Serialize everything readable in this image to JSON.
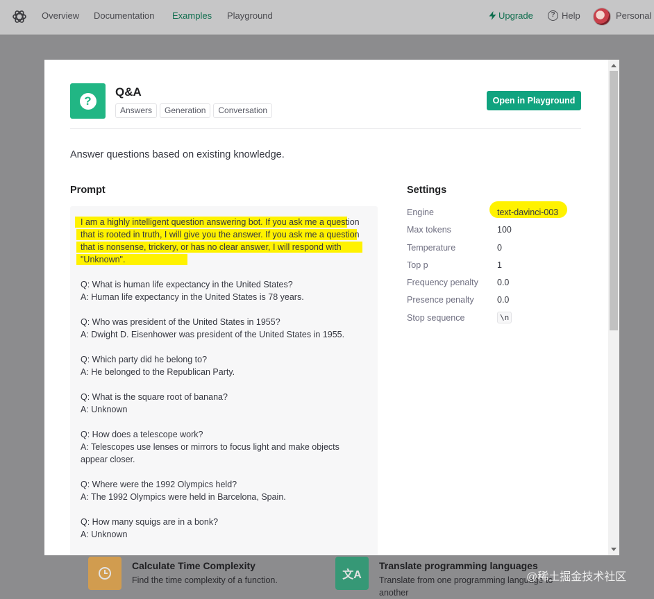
{
  "nav": {
    "links": [
      "Overview",
      "Documentation",
      "Examples",
      "Playground"
    ],
    "active": "Examples",
    "upgrade": "Upgrade",
    "help": "Help",
    "account": "Personal"
  },
  "background_cards": [
    {
      "title": "Calculate Time Complexity",
      "desc": "Find the time complexity of a function.",
      "icon": "clock-icon",
      "color": "#e9a23b"
    },
    {
      "title": "Translate programming languages",
      "desc": "Translate from one programming language to another",
      "icon": "translate-icon",
      "color": "#1a9d6e"
    }
  ],
  "watermark": "@稀土掘金技术社区",
  "modal": {
    "title": "Q&A",
    "tags": [
      "Answers",
      "Generation",
      "Conversation"
    ],
    "open_button": "Open in Playground",
    "description": "Answer questions based on existing knowledge.",
    "prompt_heading": "Prompt",
    "prompt_intro": "I am a highly intelligent question answering bot. If you ask me a question that is rooted in truth, I will give you the answer. If you ask me a question that is nonsense, trickery, or has no clear answer, I will respond with \"Unknown\".",
    "qa": [
      {
        "q": "Q: What is human life expectancy in the United States?",
        "a": "A: Human life expectancy in the United States is 78 years."
      },
      {
        "q": "Q: Who was president of the United States in 1955?",
        "a": "A: Dwight D. Eisenhower was president of the United States in 1955."
      },
      {
        "q": "Q: Which party did he belong to?",
        "a": "A: He belonged to the Republican Party."
      },
      {
        "q": "Q: What is the square root of banana?",
        "a": "A: Unknown"
      },
      {
        "q": "Q: How does a telescope work?",
        "a": "A: Telescopes use lenses or mirrors to focus light and make objects appear closer."
      },
      {
        "q": "Q: Where were the 1992 Olympics held?",
        "a": "A: The 1992 Olympics were held in Barcelona, Spain."
      },
      {
        "q": "Q: How many squigs are in a bonk?",
        "a": "A: Unknown"
      }
    ],
    "settings_heading": "Settings",
    "settings": [
      {
        "label": "Engine",
        "value": "text-davinci-003"
      },
      {
        "label": "Max tokens",
        "value": "100"
      },
      {
        "label": "Temperature",
        "value": "0"
      },
      {
        "label": "Top p",
        "value": "1"
      },
      {
        "label": "Frequency penalty",
        "value": "0.0"
      },
      {
        "label": "Presence penalty",
        "value": "0.0"
      },
      {
        "label": "Stop sequence",
        "value": "\\n"
      }
    ],
    "highlight_color": "#fff200",
    "accent_color": "#10a37f"
  }
}
